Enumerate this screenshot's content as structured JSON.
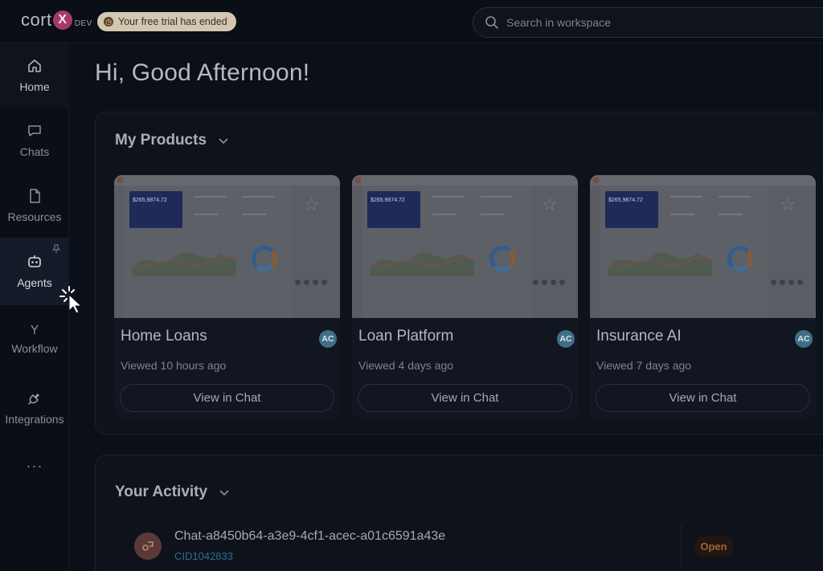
{
  "header": {
    "logo_text": "cort",
    "logo_mark": "X",
    "logo_env": "DEV",
    "trial_badge": "Your free trial has ended",
    "search_placeholder": "Search in workspace"
  },
  "sidebar": {
    "items": [
      {
        "label": "Home",
        "icon": "home-icon"
      },
      {
        "label": "Chats",
        "icon": "chat-icon"
      },
      {
        "label": "Resources",
        "icon": "document-icon"
      },
      {
        "label": "Agents",
        "icon": "robot-icon",
        "active": true
      },
      {
        "label": "Workflow",
        "icon": "workflow-icon"
      },
      {
        "label": "Integrations",
        "icon": "plug-icon"
      }
    ],
    "more_label": "···"
  },
  "main": {
    "greeting": "Hi, Good Afternoon!",
    "products": {
      "title": "My Products",
      "cards": [
        {
          "name": "Home Loans",
          "viewed": "Viewed 10 hours ago",
          "avatar": "AC",
          "button": "View in Chat",
          "thumb_balance": "$265,9874.72"
        },
        {
          "name": "Loan Platform",
          "viewed": "Viewed 4 days ago",
          "avatar": "AC",
          "button": "View in Chat",
          "thumb_balance": "$265,9874.72"
        },
        {
          "name": "Insurance AI",
          "viewed": "Viewed 7 days ago",
          "avatar": "AC",
          "button": "View in Chat",
          "thumb_balance": "$265,9874.72"
        }
      ]
    },
    "activity": {
      "title": "Your Activity",
      "items": [
        {
          "title": "Chat-a8450b64-a3e9-4cf1-acec-a01c6591a43e",
          "id": "CID1042833",
          "status": "Open"
        }
      ]
    }
  },
  "colors": {
    "background": "#0b0f17",
    "accent_logo": "#a33a6a",
    "status_open": "#a0643a",
    "id_link": "#2d6f8f"
  }
}
